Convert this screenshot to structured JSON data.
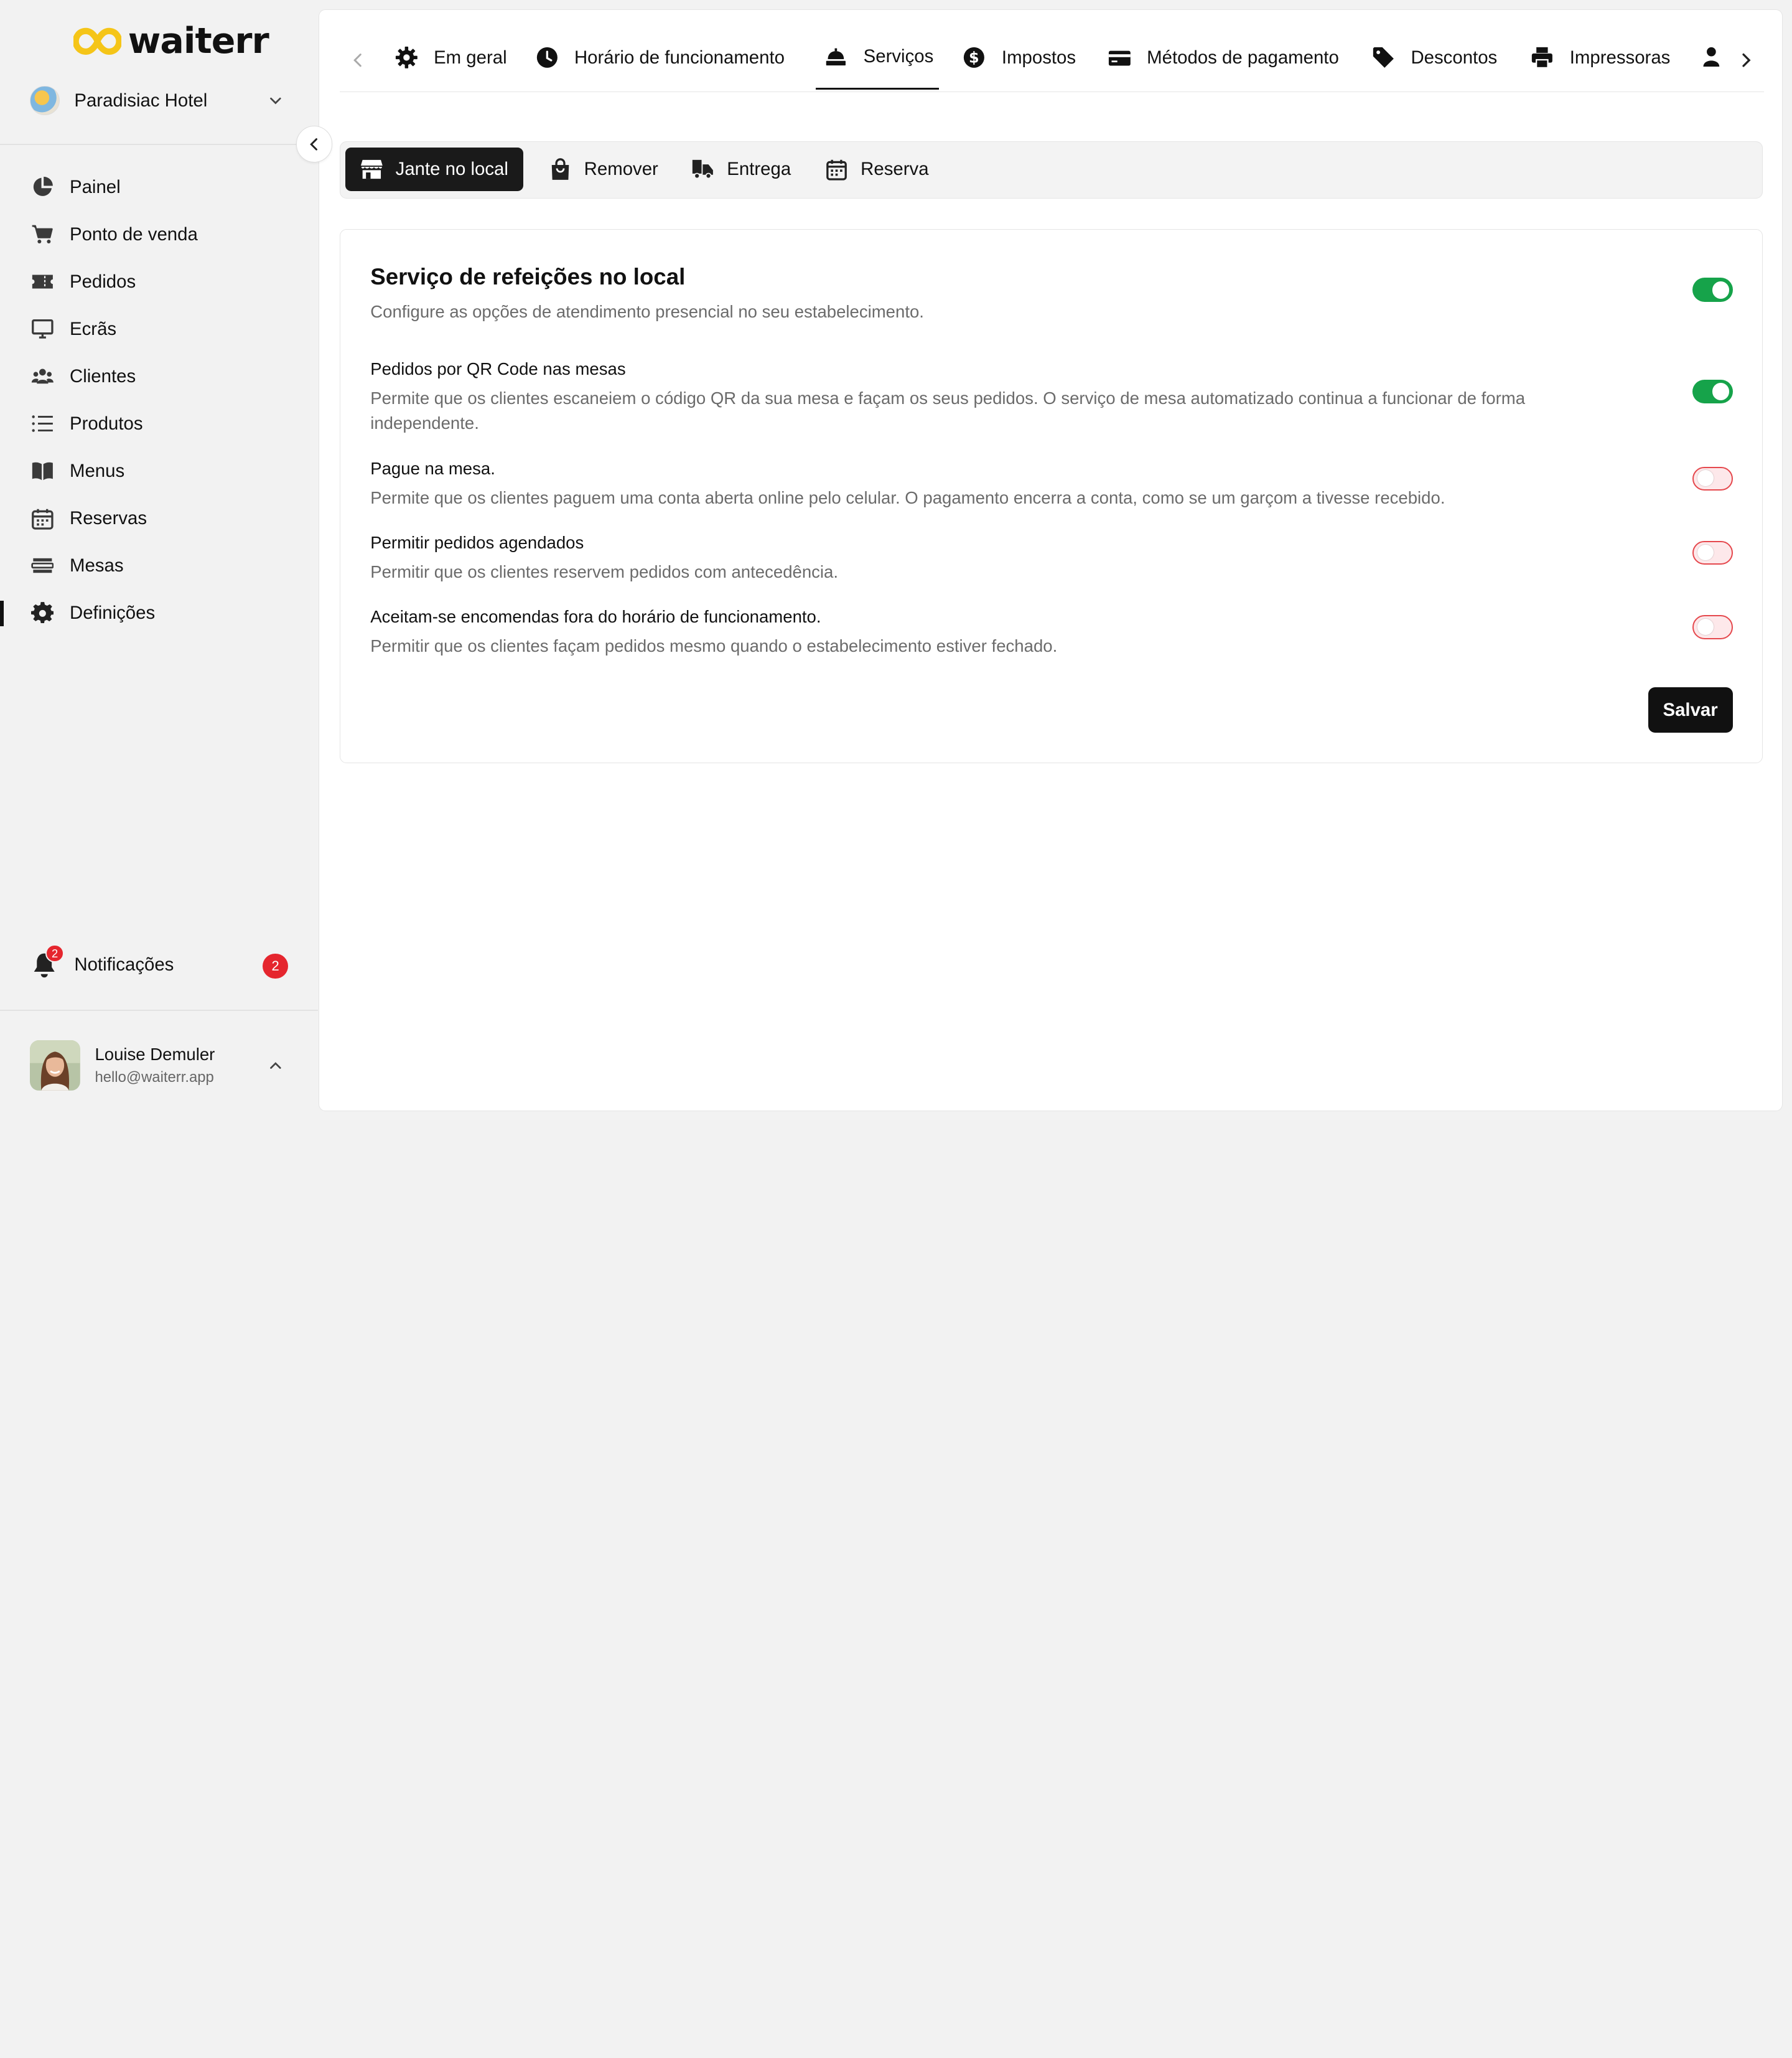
{
  "brand": {
    "name": "waiterr",
    "accent": "#f5c518"
  },
  "hotel": {
    "name": "Paradisiac Hotel"
  },
  "sidebar": {
    "items": [
      {
        "label": "Painel",
        "icon": "pie-chart-icon"
      },
      {
        "label": "Ponto de venda",
        "icon": "cart-icon"
      },
      {
        "label": "Pedidos",
        "icon": "ticket-icon"
      },
      {
        "label": "Ecrãs",
        "icon": "monitor-icon"
      },
      {
        "label": "Clientes",
        "icon": "users-icon"
      },
      {
        "label": "Produtos",
        "icon": "list-icon"
      },
      {
        "label": "Menus",
        "icon": "book-icon"
      },
      {
        "label": "Reservas",
        "icon": "calendar-icon"
      },
      {
        "label": "Mesas",
        "icon": "table-icon"
      },
      {
        "label": "Definições",
        "icon": "gear-icon",
        "active": true
      }
    ],
    "notifications": {
      "label": "Notificações",
      "count": "2"
    },
    "user": {
      "name": "Louise Demuler",
      "email": "hello@waiterr.app"
    }
  },
  "tabs": [
    {
      "label": "Em geral",
      "icon": "gear-icon"
    },
    {
      "label": "Horário de funcionamento",
      "icon": "clock-icon"
    },
    {
      "label": "Serviços",
      "icon": "service-bell-icon",
      "active": true
    },
    {
      "label": "Impostos",
      "icon": "dollar-circle-icon"
    },
    {
      "label": "Métodos de pagamento",
      "icon": "credit-card-icon"
    },
    {
      "label": "Descontos",
      "icon": "tag-icon"
    },
    {
      "label": "Impressoras",
      "icon": "printer-icon"
    },
    {
      "label": "",
      "icon": "user-icon"
    }
  ],
  "subtabs": [
    {
      "label": "Jante no local",
      "icon": "store-icon",
      "active": true
    },
    {
      "label": "Remover",
      "icon": "bag-icon"
    },
    {
      "label": "Entrega",
      "icon": "truck-icon"
    },
    {
      "label": "Reserva",
      "icon": "calendar-icon"
    }
  ],
  "card": {
    "title": "Serviço de refeições no local",
    "description": "Configure as opções de atendimento presencial no seu estabelecimento.",
    "enabled": true,
    "options": [
      {
        "title": "Pedidos por QR Code nas mesas",
        "description": "Permite que os clientes escaneiem o código QR da sua mesa e façam os seus pedidos. O serviço de mesa automatizado continua a funcionar de forma independente.",
        "enabled": true
      },
      {
        "title": "Pague na mesa.",
        "description": "Permite que os clientes paguem uma conta aberta online pelo celular. O pagamento encerra a conta, como se um garçom a tivesse recebido.",
        "enabled": false
      },
      {
        "title": "Permitir pedidos agendados",
        "description": "Permitir que os clientes reservem pedidos com antecedência.",
        "enabled": false
      },
      {
        "title": "Aceitam-se encomendas fora do horário de funcionamento.",
        "description": "Permitir que os clientes façam pedidos mesmo quando o estabelecimento estiver fechado.",
        "enabled": false
      }
    ],
    "save_label": "Salvar"
  },
  "colors": {
    "toggle_on": "#16a34a",
    "toggle_off_border": "#e5484d",
    "badge": "#e5262e"
  }
}
